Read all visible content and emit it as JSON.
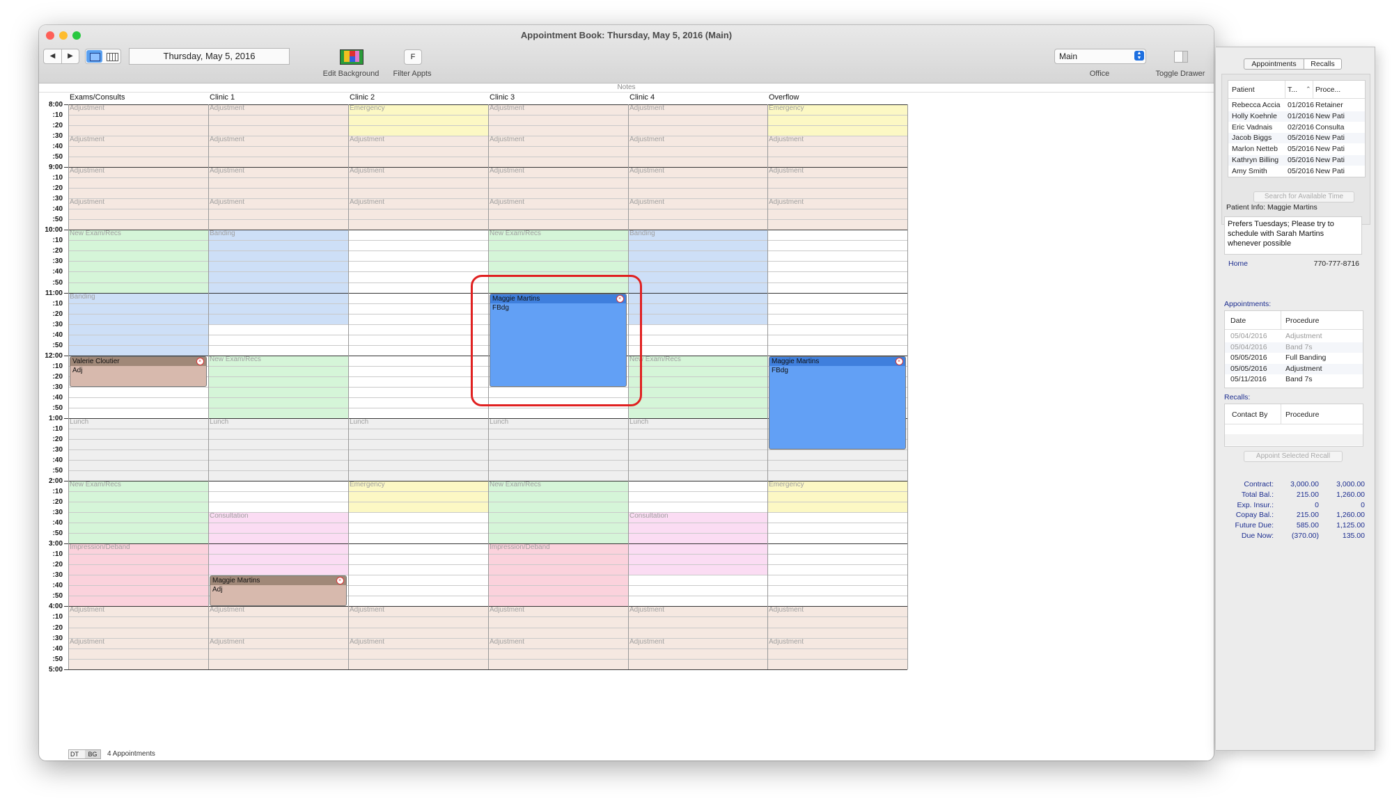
{
  "window": {
    "title": "Appointment Book: Thursday, May 5, 2016 (Main)",
    "date": "Thursday, May 5, 2016",
    "edit_background_label": "Edit Background",
    "filter_label": "Filter Appts",
    "filter_button": "F",
    "office_value": "Main",
    "office_label": "Office",
    "toggle_drawer_label": "Toggle Drawer",
    "notes_label": "Notes"
  },
  "columns": [
    "Exams/Consults",
    "Clinic 1",
    "Clinic 2",
    "Clinic 3",
    "Clinic 4",
    "Overflow"
  ],
  "time_labels": [
    "8:00",
    ":10",
    ":20",
    ":30",
    ":40",
    ":50",
    "9:00",
    ":10",
    ":20",
    ":30",
    ":40",
    ":50",
    "10:00",
    ":10",
    ":20",
    ":30",
    ":40",
    ":50",
    "11:00",
    ":10",
    ":20",
    ":30",
    ":40",
    ":50",
    "12:00",
    ":10",
    ":20",
    ":30",
    ":40",
    ":50",
    "1:00",
    ":10",
    ":20",
    ":30",
    ":40",
    ":50",
    "2:00",
    ":10",
    ":20",
    ":30",
    ":40",
    ":50",
    "3:00",
    ":10",
    ":20",
    ":30",
    ":40",
    ":50",
    "4:00",
    ":10",
    ":20",
    ":30",
    ":40",
    ":50",
    "5:00"
  ],
  "block_colors": {
    "Adjustment": "#f5e8e1",
    "Emergency": "#fcf8c4",
    "New Exam/Recs": "#d5f5d8",
    "Banding": "#cddff7",
    "Lunch": "#efefef",
    "Consultation": "#fbdcf3",
    "Impression/Deband": "#fbd2dc"
  },
  "schedule": [
    [
      {
        "s": 0,
        "d": 3,
        "l": "Adjustment"
      },
      {
        "s": 3,
        "d": 3,
        "l": "Adjustment"
      },
      {
        "s": 6,
        "d": 3,
        "l": "Adjustment"
      },
      {
        "s": 9,
        "d": 3,
        "l": "Adjustment"
      },
      {
        "s": 12,
        "d": 6,
        "l": "New Exam/Recs"
      },
      {
        "s": 18,
        "d": 6,
        "l": "Banding"
      },
      {
        "s": 30,
        "d": 6,
        "l": "Lunch"
      },
      {
        "s": 36,
        "d": 6,
        "l": "New Exam/Recs"
      },
      {
        "s": 42,
        "d": 6,
        "l": "Impression/Deband"
      },
      {
        "s": 48,
        "d": 3,
        "l": "Adjustment"
      },
      {
        "s": 51,
        "d": 3,
        "l": "Adjustment"
      }
    ],
    [
      {
        "s": 0,
        "d": 3,
        "l": "Adjustment"
      },
      {
        "s": 3,
        "d": 3,
        "l": "Adjustment"
      },
      {
        "s": 6,
        "d": 3,
        "l": "Adjustment"
      },
      {
        "s": 9,
        "d": 3,
        "l": "Adjustment"
      },
      {
        "s": 12,
        "d": 9,
        "l": "Banding"
      },
      {
        "s": 24,
        "d": 6,
        "l": "New Exam/Recs"
      },
      {
        "s": 30,
        "d": 6,
        "l": "Lunch"
      },
      {
        "s": 39,
        "d": 6,
        "l": "Consultation"
      },
      {
        "s": 48,
        "d": 3,
        "l": "Adjustment"
      },
      {
        "s": 51,
        "d": 3,
        "l": "Adjustment"
      }
    ],
    [
      {
        "s": 0,
        "d": 3,
        "l": "Emergency"
      },
      {
        "s": 3,
        "d": 3,
        "l": "Adjustment"
      },
      {
        "s": 6,
        "d": 3,
        "l": "Adjustment"
      },
      {
        "s": 9,
        "d": 3,
        "l": "Adjustment"
      },
      {
        "s": 30,
        "d": 6,
        "l": "Lunch"
      },
      {
        "s": 36,
        "d": 3,
        "l": "Emergency"
      },
      {
        "s": 48,
        "d": 3,
        "l": "Adjustment"
      },
      {
        "s": 51,
        "d": 3,
        "l": "Adjustment"
      }
    ],
    [
      {
        "s": 0,
        "d": 3,
        "l": "Adjustment"
      },
      {
        "s": 3,
        "d": 3,
        "l": "Adjustment"
      },
      {
        "s": 6,
        "d": 3,
        "l": "Adjustment"
      },
      {
        "s": 9,
        "d": 3,
        "l": "Adjustment"
      },
      {
        "s": 12,
        "d": 6,
        "l": "New Exam/Recs"
      },
      {
        "s": 30,
        "d": 6,
        "l": "Lunch"
      },
      {
        "s": 36,
        "d": 6,
        "l": "New Exam/Recs"
      },
      {
        "s": 42,
        "d": 6,
        "l": "Impression/Deband"
      },
      {
        "s": 48,
        "d": 3,
        "l": "Adjustment"
      },
      {
        "s": 51,
        "d": 3,
        "l": "Adjustment"
      }
    ],
    [
      {
        "s": 0,
        "d": 3,
        "l": "Adjustment"
      },
      {
        "s": 3,
        "d": 3,
        "l": "Adjustment"
      },
      {
        "s": 6,
        "d": 3,
        "l": "Adjustment"
      },
      {
        "s": 9,
        "d": 3,
        "l": "Adjustment"
      },
      {
        "s": 12,
        "d": 9,
        "l": "Banding"
      },
      {
        "s": 24,
        "d": 6,
        "l": "New Exam/Recs"
      },
      {
        "s": 30,
        "d": 6,
        "l": "Lunch"
      },
      {
        "s": 39,
        "d": 6,
        "l": "Consultation"
      },
      {
        "s": 48,
        "d": 3,
        "l": "Adjustment"
      },
      {
        "s": 51,
        "d": 3,
        "l": "Adjustment"
      }
    ],
    [
      {
        "s": 0,
        "d": 3,
        "l": "Emergency"
      },
      {
        "s": 3,
        "d": 3,
        "l": "Adjustment"
      },
      {
        "s": 6,
        "d": 3,
        "l": "Adjustment"
      },
      {
        "s": 9,
        "d": 3,
        "l": "Adjustment"
      },
      {
        "s": 30,
        "d": 6,
        "l": "Lunch"
      },
      {
        "s": 36,
        "d": 3,
        "l": "Emergency"
      },
      {
        "s": 48,
        "d": 3,
        "l": "Adjustment"
      },
      {
        "s": 51,
        "d": 3,
        "l": "Adjustment"
      }
    ]
  ],
  "appointments": [
    {
      "col": 0,
      "s": 24,
      "d": 3,
      "name": "Valerie Cloutier",
      "proc": "Adj",
      "head": "#a08878",
      "body": "#d7b9ad"
    },
    {
      "col": 1,
      "s": 45,
      "d": 3,
      "name": "Maggie Martins",
      "proc": "Adj",
      "head": "#a08878",
      "body": "#d7b9ad"
    },
    {
      "col": 3,
      "s": 18,
      "d": 9,
      "name": "Maggie Martins",
      "proc": "FBdg",
      "head": "#3f7fdd",
      "body": "#62a0f5"
    },
    {
      "col": 5,
      "s": 24,
      "d": 9,
      "name": "Maggie Martins",
      "proc": "FBdg",
      "head": "#3f7fdd",
      "body": "#62a0f5"
    }
  ],
  "status": {
    "dt": "DT",
    "bg": "BG",
    "count": "4 Appointments"
  },
  "drawer": {
    "tabs": [
      "Appointments",
      "Recalls"
    ],
    "recall_headers": [
      "Patient",
      "T...",
      "Proce..."
    ],
    "recall_rows": [
      [
        "Rebecca Accia",
        "01/2016",
        "Retainer"
      ],
      [
        "Holly Koehnle",
        "01/2016",
        "New Pati"
      ],
      [
        "Eric Vadnais",
        "02/2016",
        "Consulta"
      ],
      [
        "Jacob Biggs",
        "05/2016",
        "New Pati"
      ],
      [
        "Marlon Netteb",
        "05/2016",
        "New Pati"
      ],
      [
        "Kathryn Billing",
        "05/2016",
        "New Pati"
      ],
      [
        "Amy Smith",
        "05/2016",
        "New Pati"
      ]
    ],
    "search_button": "Search for Available Time",
    "patient_info_label": "Patient Info: Maggie Martins",
    "patient_note": "Prefers Tuesdays; Please try to schedule with Sarah Martins whenever possible",
    "phone_label": "Home",
    "phone": "770-777-8716",
    "appointments_label": "Appointments:",
    "appt_headers": [
      "Date",
      "Procedure"
    ],
    "appt_rows": [
      [
        "05/04/2016",
        "Adjustment",
        true
      ],
      [
        "05/04/2016",
        "Band 7s",
        true
      ],
      [
        "05/05/2016",
        "Full Banding",
        false
      ],
      [
        "05/05/2016",
        "Adjustment",
        false
      ],
      [
        "05/11/2016",
        "Band 7s",
        false
      ]
    ],
    "recalls_label": "Recalls:",
    "recall_table_headers": [
      "Contact By",
      "Procedure"
    ],
    "appoint_recall_button": "Appoint Selected Recall",
    "finance": [
      [
        "Contract:",
        "3,000.00",
        "3,000.00"
      ],
      [
        "Total Bal.:",
        "215.00",
        "1,260.00"
      ],
      [
        "Exp. Insur.:",
        "0",
        "0"
      ],
      [
        "Copay Bal.:",
        "215.00",
        "1,260.00"
      ],
      [
        "Future Due:",
        "585.00",
        "1,125.00"
      ],
      [
        "Due Now:",
        "(370.00)",
        "135.00"
      ]
    ]
  }
}
